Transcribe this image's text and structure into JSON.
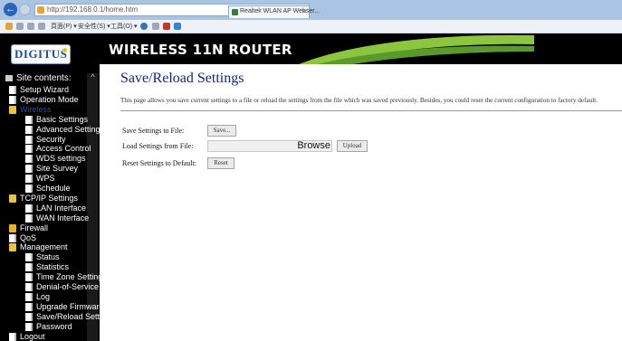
{
  "browser": {
    "url": "http://192.168.0.1/home.htm",
    "search_icon": "magnifier-icon",
    "refresh_icon": "refresh-icon",
    "tab_title": "Realtek WLAN AP Webser...",
    "tab_close": "×",
    "back_icon": "←",
    "menubar": {
      "page": "頁面(P) ▾",
      "safety": "安全性(S) ▾",
      "tools": "工具(O) ▾"
    }
  },
  "brand": {
    "logo": "DIGITUS",
    "header_title": "WIRELESS 11N ROUTER",
    "accent_color": "#8cc63f"
  },
  "sidebar": {
    "site_contents": "Site contents:",
    "scroll_up": "^",
    "items": [
      {
        "label": "Setup Wizard",
        "icon": "doc"
      },
      {
        "label": "Operation Mode",
        "icon": "doc"
      },
      {
        "label": "Wireless",
        "icon": "folder-open"
      },
      {
        "label": "Basic Settings",
        "icon": "doc"
      },
      {
        "label": "Advanced Settings",
        "icon": "doc"
      },
      {
        "label": "Security",
        "icon": "doc"
      },
      {
        "label": "Access Control",
        "icon": "doc"
      },
      {
        "label": "WDS settings",
        "icon": "doc"
      },
      {
        "label": "Site Survey",
        "icon": "doc"
      },
      {
        "label": "WPS",
        "icon": "doc"
      },
      {
        "label": "Schedule",
        "icon": "doc"
      },
      {
        "label": "TCP/IP Settings",
        "icon": "folder-open"
      },
      {
        "label": "LAN Interface",
        "icon": "doc"
      },
      {
        "label": "WAN Interface",
        "icon": "doc"
      },
      {
        "label": "Firewall",
        "icon": "folder"
      },
      {
        "label": "QoS",
        "icon": "doc"
      },
      {
        "label": "Management",
        "icon": "folder-open"
      },
      {
        "label": "Status",
        "icon": "doc"
      },
      {
        "label": "Statistics",
        "icon": "doc"
      },
      {
        "label": "Time Zone Setting",
        "icon": "doc"
      },
      {
        "label": "Denial-of-Service",
        "icon": "doc"
      },
      {
        "label": "Log",
        "icon": "doc"
      },
      {
        "label": "Upgrade Firmware",
        "icon": "doc"
      },
      {
        "label": "Save/Reload Settings",
        "icon": "doc"
      },
      {
        "label": "Password",
        "icon": "doc"
      },
      {
        "label": "Logout",
        "icon": "doc"
      }
    ]
  },
  "main": {
    "title": "Save/Reload Settings",
    "description": "This page allows you save current settings to a file or reload the settings from the file which was saved previously. Besides, you could reset the current configuration to factory default.",
    "rows": {
      "save_label": "Save Settings to File:",
      "save_button": "Save...",
      "load_label": "Load Settings from File:",
      "browse_button": "Browse",
      "upload_button": "Upload",
      "reset_label": "Reset Settings to Default:",
      "reset_button": "Reset"
    }
  }
}
